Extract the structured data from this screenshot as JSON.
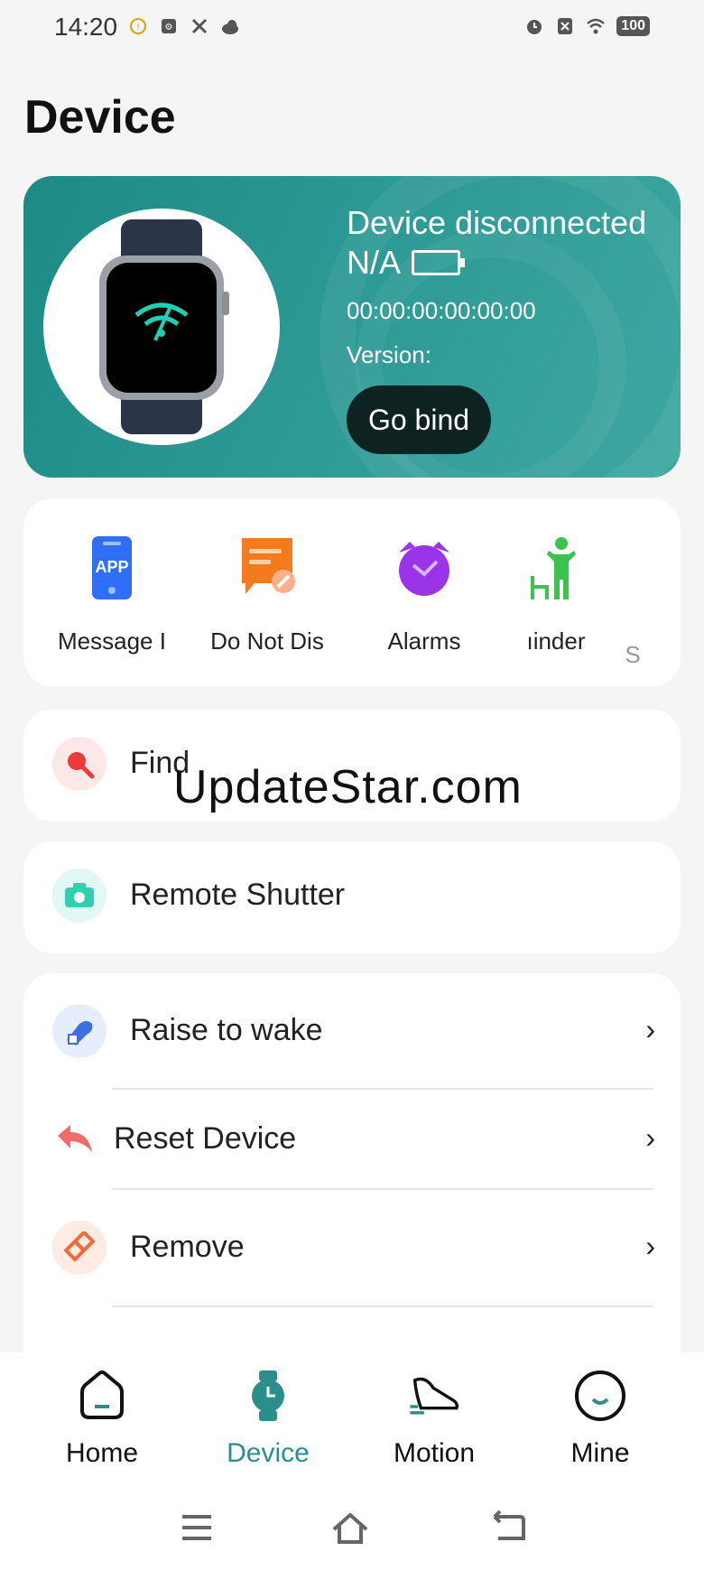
{
  "status_bar": {
    "time": "14:20",
    "battery": "100",
    "left_icons": [
      "notification-icon",
      "usb-debug-icon",
      "tools-icon",
      "cloud-icon"
    ],
    "right_icons": [
      "alarm-icon",
      "sim-off-icon",
      "wifi-icon"
    ]
  },
  "page": {
    "title": "Device"
  },
  "device_card": {
    "status": "Device disconnected",
    "name": "N/A",
    "mac": "00:00:00:00:00:00",
    "version_label": "Version:",
    "bind_button": "Go bind",
    "accent_color": "#2e9a95"
  },
  "quick_actions": [
    {
      "label": "Message I",
      "icon": "app-message-icon"
    },
    {
      "label": "Do Not Dis",
      "icon": "do-not-disturb-icon"
    },
    {
      "label": "Alarms",
      "icon": "alarm-clock-icon"
    },
    {
      "label": "ıinder",
      "icon": "sedentary-reminder-icon"
    },
    {
      "label": "S",
      "icon": "more-icon"
    }
  ],
  "rows": {
    "find": "Find",
    "remote_shutter": "Remote Shutter",
    "raise_to_wake": "Raise to wake",
    "reset_device": "Reset Device",
    "remove": "Remove"
  },
  "watermark": "UpdateStar.com",
  "tabs": [
    {
      "label": "Home",
      "icon": "home-icon",
      "active": false
    },
    {
      "label": "Device",
      "icon": "watch-icon",
      "active": true
    },
    {
      "label": "Motion",
      "icon": "shoe-icon",
      "active": false
    },
    {
      "label": "Mine",
      "icon": "profile-icon",
      "active": false
    }
  ],
  "colors": {
    "accent": "#2a8f8a",
    "background": "#f5f5f5"
  }
}
